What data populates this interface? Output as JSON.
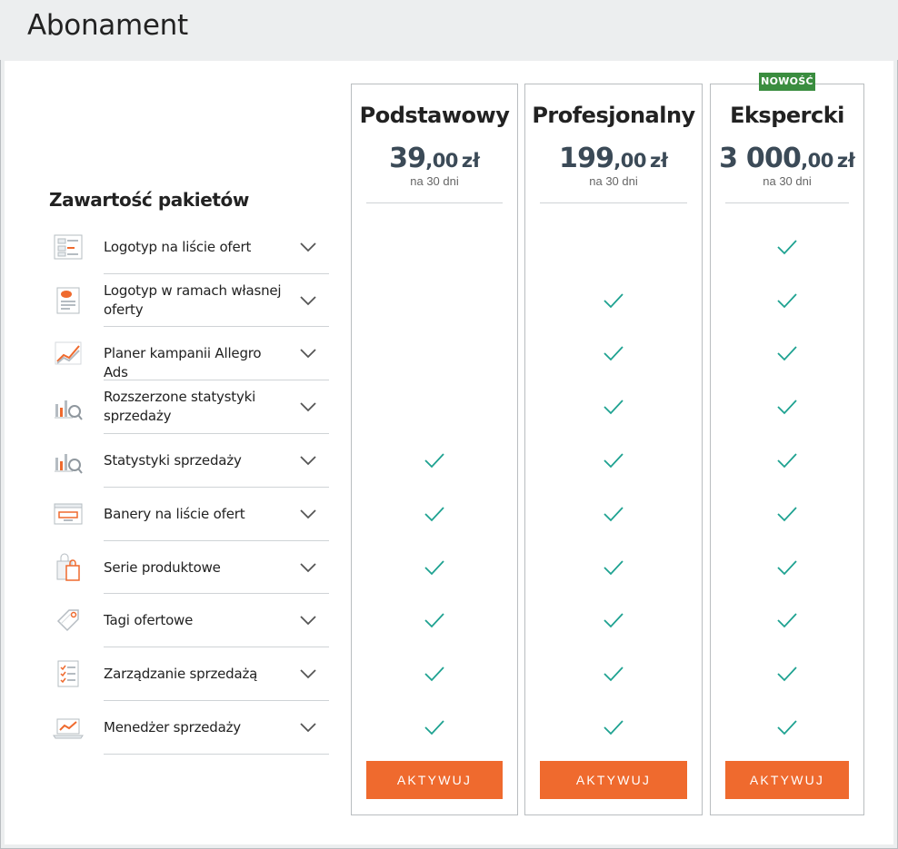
{
  "page": {
    "title": "Abonament"
  },
  "section_title": "Zawartość pakietów",
  "features": [
    {
      "label": "Logotyp na liście ofert",
      "icon": "logo-list-icon",
      "plans": [
        false,
        false,
        true
      ]
    },
    {
      "label": "Logotyp w ramach własnej oferty",
      "icon": "logo-offer-icon",
      "plans": [
        false,
        true,
        true
      ]
    },
    {
      "label": "Planer kampanii Allegro Ads",
      "icon": "campaign-chart-icon",
      "plans": [
        false,
        true,
        true
      ]
    },
    {
      "label": "Rozszerzone statystyki sprzedaży",
      "icon": "stats-magnifier-icon",
      "plans": [
        false,
        true,
        true
      ]
    },
    {
      "label": "Statystyki sprzedaży",
      "icon": "stats-magnifier-icon",
      "plans": [
        true,
        true,
        true
      ]
    },
    {
      "label": "Banery na liście ofert",
      "icon": "banner-icon",
      "plans": [
        true,
        true,
        true
      ]
    },
    {
      "label": "Serie produktowe",
      "icon": "shopping-bags-icon",
      "plans": [
        true,
        true,
        true
      ]
    },
    {
      "label": "Tagi ofertowe",
      "icon": "tag-icon",
      "plans": [
        true,
        true,
        true
      ]
    },
    {
      "label": "Zarządzanie sprzedażą",
      "icon": "checklist-icon",
      "plans": [
        true,
        true,
        true
      ]
    },
    {
      "label": "Menedżer sprzedaży",
      "icon": "laptop-chart-icon",
      "plans": [
        true,
        true,
        true
      ]
    }
  ],
  "plans": [
    {
      "name": "Podstawowy",
      "price_int": "39",
      "price_dec": ",00",
      "currency": "zł",
      "period": "na 30 dni",
      "button": "AKTYWUJ"
    },
    {
      "name": "Profesjonalny",
      "price_int": "199",
      "price_dec": ",00",
      "currency": "zł",
      "period": "na 30 dni",
      "button": "AKTYWUJ"
    },
    {
      "name": "Ekspercki",
      "price_int": "3 000",
      "price_dec": ",00",
      "currency": "zł",
      "period": "na 30 dni",
      "button": "AKTYWUJ",
      "badge": "NOWOŚĆ"
    }
  ],
  "colors": {
    "accent": "#ef6a2e",
    "check": "#1ea291",
    "badge": "#3a8d3f",
    "price": "#3b4a57"
  }
}
